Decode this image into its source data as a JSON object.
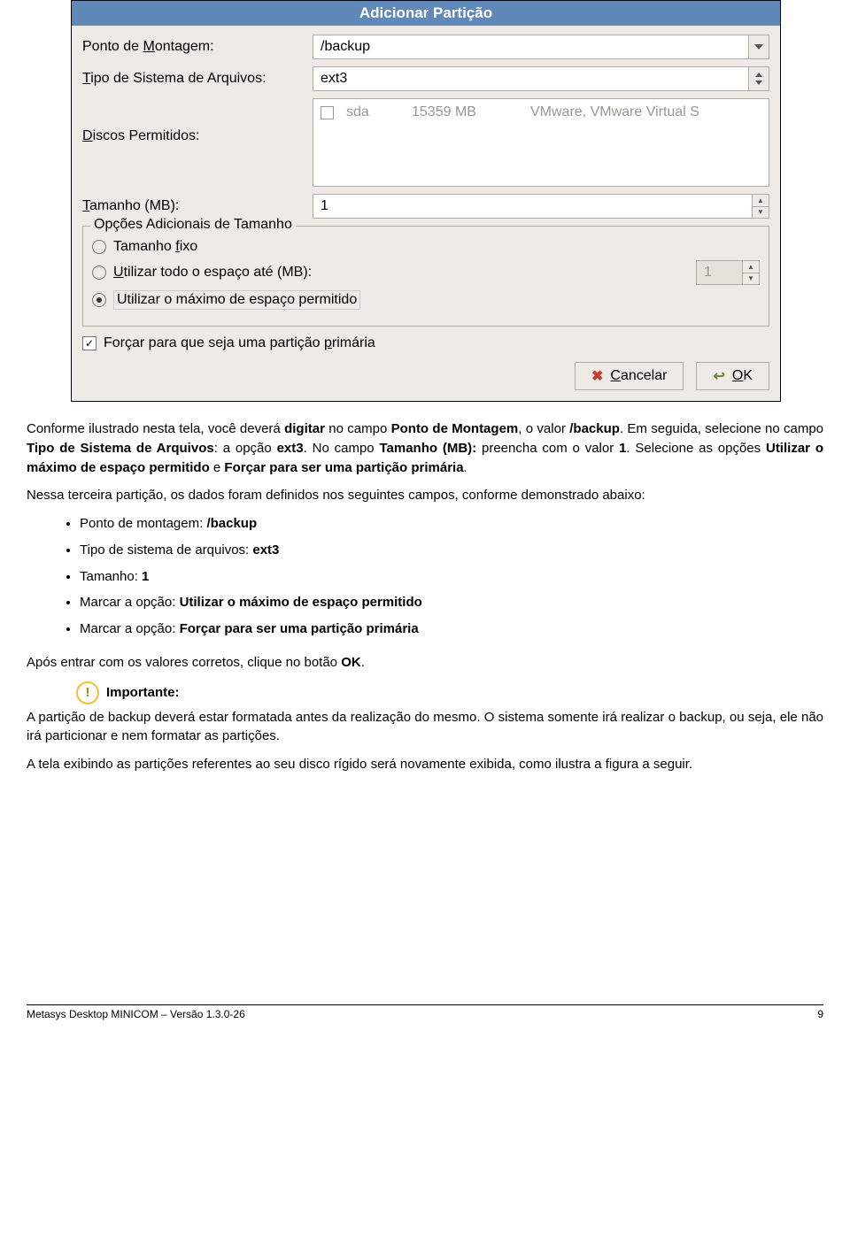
{
  "dialog": {
    "title": "Adicionar Partição",
    "mount_label_pre": "Ponto de ",
    "mount_label_u": "M",
    "mount_label_post": "ontagem:",
    "mount_value": "/backup",
    "fs_label_u": "T",
    "fs_label_post": "ipo de Sistema de Arquivos:",
    "fs_value": "ext3",
    "drives_label_u": "D",
    "drives_label_post": "iscos Permitidos:",
    "disk": {
      "name": "sda",
      "size": "15359 MB",
      "model": "VMware, VMware Virtual S"
    },
    "size_label_u": "T",
    "size_label_post": "amanho (MB):",
    "size_value": "1",
    "additional_legend": "Opções Adicionais de Tamanho",
    "opt_fixed_pre": "Tamanho ",
    "opt_fixed_u": "f",
    "opt_fixed_post": "ixo",
    "opt_fill_up_u": "U",
    "opt_fill_up_post": "tilizar todo o espaço até (MB):",
    "opt_fill_up_value": "1",
    "opt_max": "Utilizar o máximo de espaço permitido",
    "force_primary_pre": "Forçar para que seja uma partição ",
    "force_primary_u": "p",
    "force_primary_post": "rimária",
    "cancel_u": "C",
    "cancel_post": "ancelar",
    "ok_u": "O",
    "ok_post": "K"
  },
  "doc": {
    "p1a": "Conforme ilustrado nesta tela, você deverá ",
    "p1b": "digitar",
    "p1c": " no campo ",
    "p1d": "Ponto de Montagem",
    "p1e": ", o valor ",
    "p1f": "/backup",
    "p1g": ". Em seguida, selecione no campo ",
    "p1h": "Tipo de Sistema de Arquivos",
    "p1i": ": a opção ",
    "p1j": "ext3",
    "p1k": ". No campo ",
    "p1l": "Tamanho (MB):",
    "p1m": " preencha com o valor ",
    "p1n": "1",
    "p1o": ". Selecione as opções ",
    "p1p": "Utilizar o máximo de espaço permitido",
    "p1q": " e ",
    "p1r": "Forçar para ser uma partição primária",
    "p1s": ".",
    "p2": "Nessa terceira partição, os dados foram definidos nos seguintes campos, conforme demonstrado abaixo:",
    "li1a": "Ponto de montagem: ",
    "li1b": "/backup",
    "li2a": "Tipo de sistema de arquivos: ",
    "li2b": "ext3",
    "li3a": "Tamanho: ",
    "li3b": "1",
    "li4a": "Marcar a opção: ",
    "li4b": "Utilizar o máximo de espaço permitido",
    "li5a": "Marcar a opção: ",
    "li5b": "Forçar para ser uma partição primária",
    "p3a": "Após entrar com os valores corretos, clique no botão ",
    "p3b": "OK",
    "p3c": ".",
    "important_label": "Importante:",
    "important_text": "A partição de backup deverá estar formatada antes da realização do mesmo. O sistema somente irá realizar o backup, ou seja, ele não irá particionar e nem formatar as partições.",
    "p4": "A tela exibindo as partições referentes ao seu disco rígido será novamente exibida, como ilustra a figura a seguir."
  },
  "footer": {
    "left": "Metasys Desktop MINICOM – Versão 1.3.0-26",
    "right": "9"
  }
}
